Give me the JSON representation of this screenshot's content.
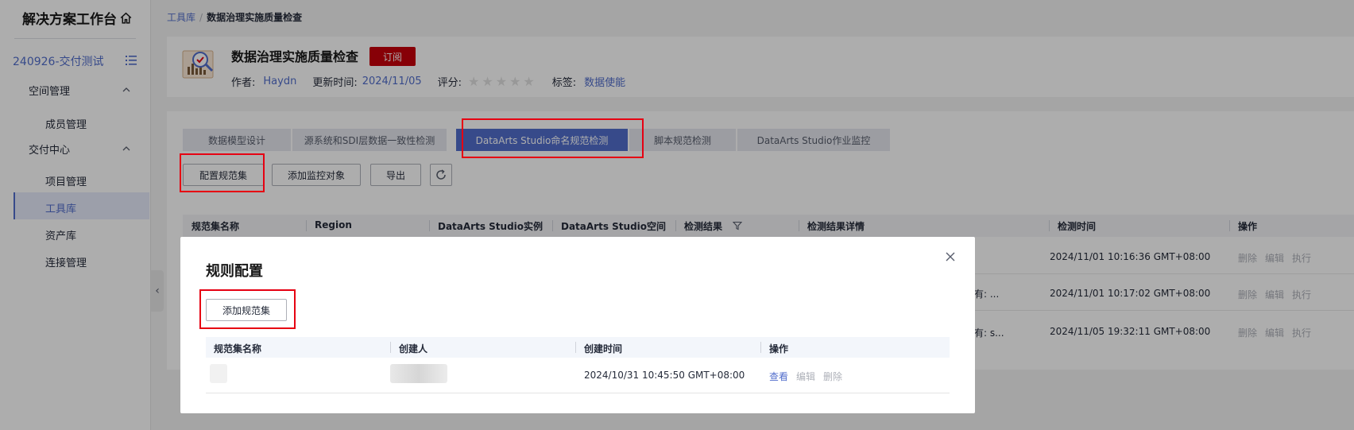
{
  "sidebar": {
    "title": "解决方案工作台",
    "project": "240926-交付测试",
    "groups": [
      {
        "label": "空间管理",
        "items": [
          "成员管理"
        ]
      },
      {
        "label": "交付中心",
        "items": [
          "项目管理",
          "工具库",
          "资产库",
          "连接管理"
        ]
      }
    ],
    "active_item": "工具库"
  },
  "breadcrumb": {
    "root": "工具库",
    "separator": "/",
    "current": "数据治理实施质量检查"
  },
  "tool": {
    "title": "数据治理实施质量检查",
    "subscribe_label": "订阅",
    "author_label": "作者:",
    "author": "Haydn",
    "updated_label": "更新时间:",
    "updated": "2024/11/05",
    "rating_label": "评分:",
    "rating": 0,
    "rating_max": 5,
    "tags_label": "标签:",
    "tag": "数据使能"
  },
  "tabs": [
    {
      "label": "数据模型设计",
      "active": false
    },
    {
      "label": "源系统和SDI层数据一致性检测",
      "active": false
    },
    {
      "label": "DataArts Studio命名规范检测",
      "active": true
    },
    {
      "label": "脚本规范检测",
      "active": false
    },
    {
      "label": "DataArts Studio作业监控",
      "active": false
    }
  ],
  "toolbar": {
    "config_label": "配置规范集",
    "add_monitor_label": "添加监控对象",
    "export_label": "导出"
  },
  "table": {
    "columns": [
      "规范集名称",
      "Region",
      "DataArts Studio实例",
      "DataArts Studio空间",
      "检测结果",
      "检测结果详情",
      "检测时间",
      "操作"
    ],
    "rows": [
      {
        "detail": "",
        "time": "2024/11/01 10:16:36 GMT+08:00",
        "ops": [
          "删除",
          "编辑",
          "执行"
        ]
      },
      {
        "detail": "有: ...",
        "time": "2024/11/01 10:17:02 GMT+08:00",
        "ops": [
          "删除",
          "编辑",
          "执行"
        ]
      },
      {
        "detail": "有: s...",
        "time": "2024/11/05 19:32:11 GMT+08:00",
        "ops": [
          "删除",
          "编辑",
          "执行"
        ]
      }
    ]
  },
  "modal": {
    "title": "规则配置",
    "add_label": "添加规范集",
    "columns": [
      "规范集名称",
      "创建人",
      "创建时间",
      "操作"
    ],
    "row": {
      "created": "2024/10/31 10:45:50 GMT+08:00",
      "ops": [
        "查看",
        "编辑",
        "删除"
      ]
    }
  },
  "colors": {
    "accent": "#526ecc",
    "subscribe": "#c7000b",
    "annotation": "#e60012"
  }
}
